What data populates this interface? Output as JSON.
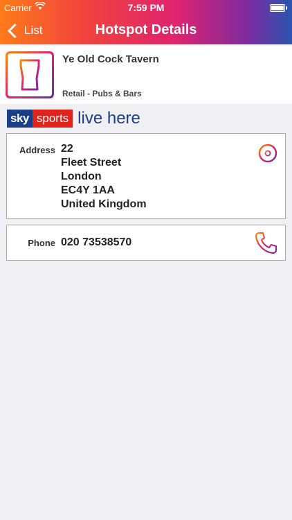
{
  "status": {
    "carrier": "Carrier",
    "time": "7:59 PM"
  },
  "nav": {
    "back_label": "List",
    "title": "Hotspot Details"
  },
  "venue": {
    "name": "Ye Old Cock Tavern",
    "category": "Retail - Pubs & Bars",
    "icon": "pint-glass-icon"
  },
  "banner": {
    "sky": "sky",
    "sports": "sports",
    "live": "live here"
  },
  "address": {
    "label": "Address",
    "lines": [
      "22",
      "Fleet Street",
      "London",
      "EC4Y 1AA",
      "United Kingdom"
    ],
    "icon": "map-pin-icon"
  },
  "phone": {
    "label": "Phone",
    "number": "020 73538570",
    "icon": "phone-icon"
  },
  "colors": {
    "accent_start": "#ff7a18",
    "accent_mid": "#e0236f",
    "accent_end": "#2a55b0",
    "sky_blue": "#1b3e88",
    "sky_red": "#e0241b"
  }
}
